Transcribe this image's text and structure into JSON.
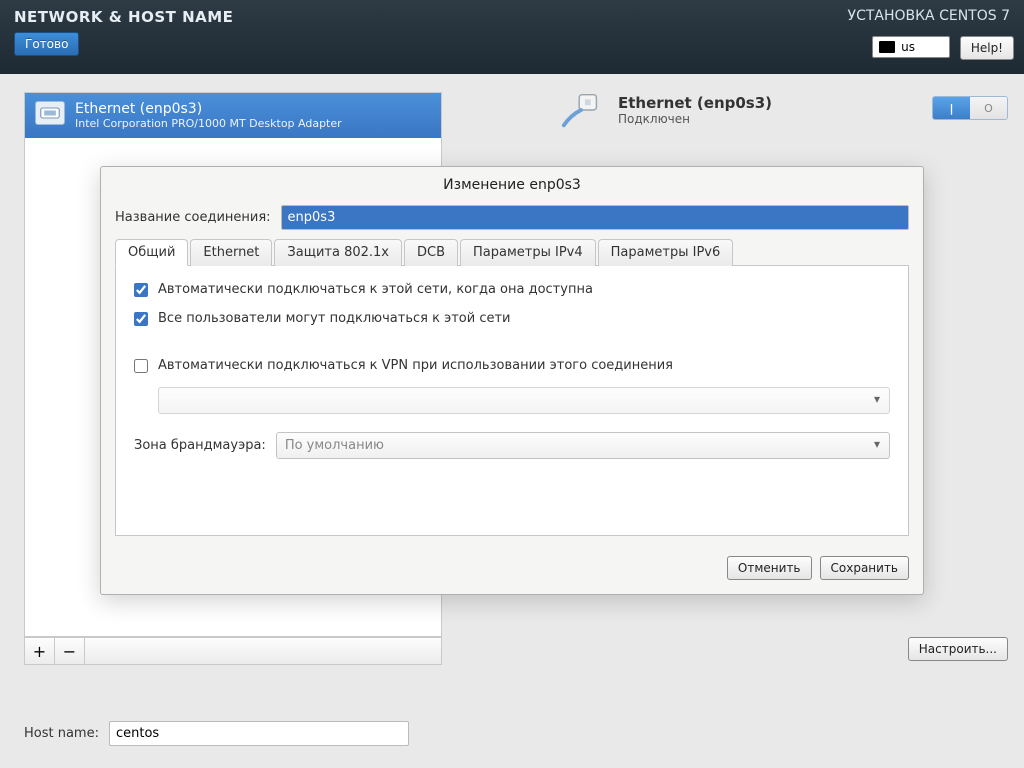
{
  "header": {
    "title": "NETWORK & HOST NAME",
    "installer": "УСТАНОВКА CENTOS 7",
    "done": "Готово",
    "lang": "us",
    "help": "Help!"
  },
  "netlist": {
    "item_title": "Ethernet (enp0s3)",
    "item_sub": "Intel Corporation PRO/1000 MT Desktop Adapter"
  },
  "summary": {
    "title": "Ethernet (enp0s3)",
    "status": "Подключен",
    "toggle_on": "|",
    "toggle_off": "O"
  },
  "configure": "Настроить...",
  "hostname": {
    "label": "Host name:",
    "value": "centos"
  },
  "dialog": {
    "title": "Изменение enp0s3",
    "conn_label": "Название соединения:",
    "conn_value": "enp0s3",
    "tabs": [
      "Общий",
      "Ethernet",
      "Защита 802.1x",
      "DCB",
      "Параметры IPv4",
      "Параметры IPv6"
    ],
    "general": {
      "chk_auto": "Автоматически подключаться к этой сети, когда она доступна",
      "chk_all": "Все пользователи могут подключаться к этой сети",
      "chk_vpn": "Автоматически подключаться к VPN при использовании этого соединения",
      "fw_label": "Зона брандмауэра:",
      "fw_value": "По умолчанию"
    },
    "cancel": "Отменить",
    "save": "Сохранить"
  }
}
